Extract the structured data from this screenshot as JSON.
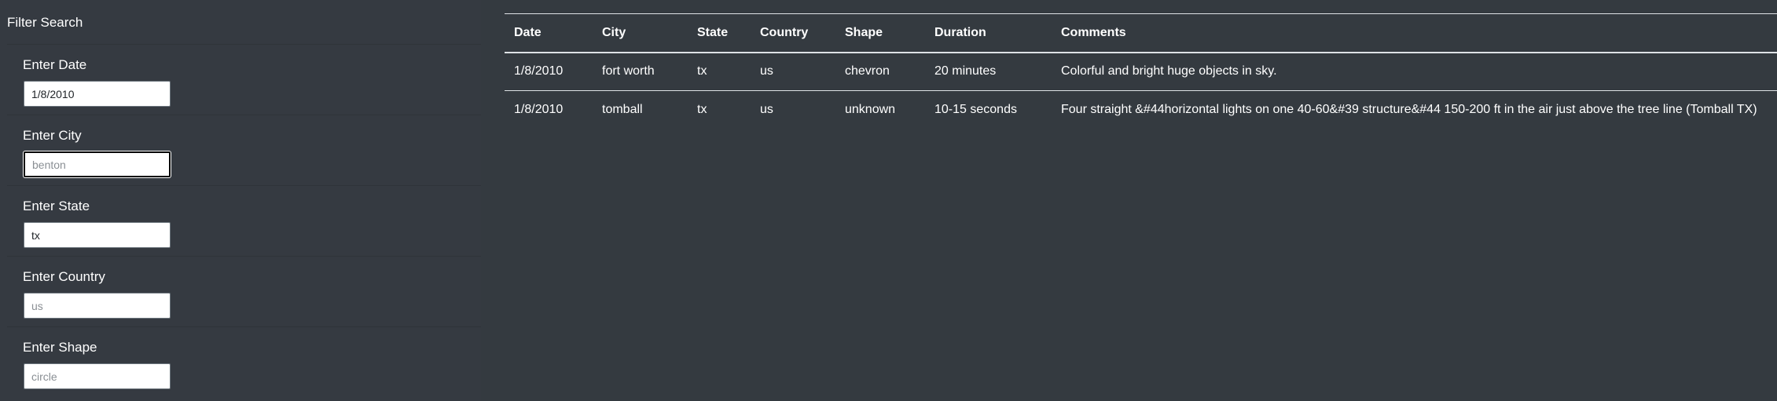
{
  "sidebar": {
    "title": "Filter Search",
    "filters": [
      {
        "label": "Enter Date",
        "value": "1/8/2010",
        "placeholder": ""
      },
      {
        "label": "Enter City",
        "value": "",
        "placeholder": "benton"
      },
      {
        "label": "Enter State",
        "value": "tx",
        "placeholder": ""
      },
      {
        "label": "Enter Country",
        "value": "",
        "placeholder": "us"
      },
      {
        "label": "Enter Shape",
        "value": "",
        "placeholder": "circle"
      }
    ]
  },
  "table": {
    "headers": [
      "Date",
      "City",
      "State",
      "Country",
      "Shape",
      "Duration",
      "Comments"
    ],
    "rows": [
      [
        "1/8/2010",
        "fort worth",
        "tx",
        "us",
        "chevron",
        "20 minutes",
        "Colorful and bright huge objects in sky."
      ],
      [
        "1/8/2010",
        "tomball",
        "tx",
        "us",
        "unknown",
        "10-15 seconds",
        "Four straight &#44horizontal lights on one 40-60&#39 structure&#44 150-200 ft in the air just above the tree line (Tomball TX)"
      ]
    ]
  }
}
